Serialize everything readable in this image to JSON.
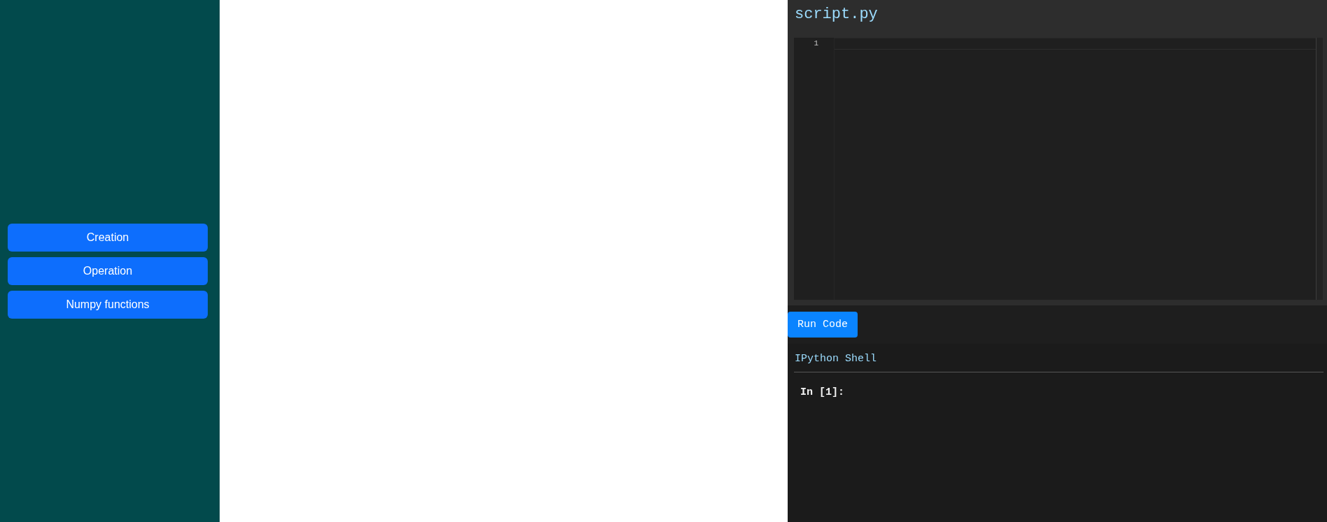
{
  "sidebar": {
    "buttons": [
      {
        "label": "Creation"
      },
      {
        "label": "Operation"
      },
      {
        "label": "Numpy functions"
      }
    ]
  },
  "editor": {
    "filename": "script.py",
    "line_numbers": [
      "1"
    ]
  },
  "run_button": {
    "label": "Run Code"
  },
  "shell": {
    "title": "IPython Shell",
    "prompt": "In [1]:"
  }
}
